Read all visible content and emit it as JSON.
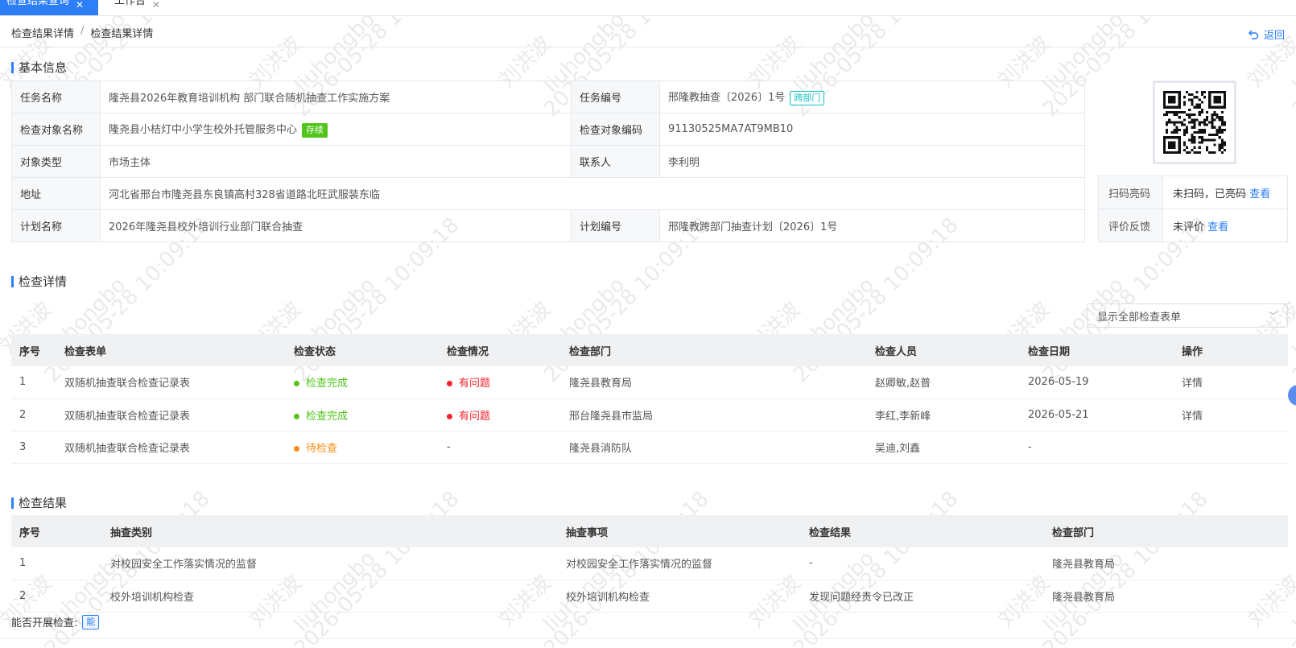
{
  "tabs": [
    {
      "label": "检查结果查询"
    },
    {
      "label": "工作台"
    }
  ],
  "breadcrumb": {
    "first": "检查结果详情",
    "second": "检查结果详情"
  },
  "back_label": "返回",
  "basic": {
    "title": "基本信息",
    "task_name_k": "任务名称",
    "task_name_v": "隆尧县2026年教育培训机构 部门联合随机抽查工作实施方案",
    "task_no_k": "任务编号",
    "task_no_v": "邢隆教抽查〔2026〕1号",
    "task_no_tag": "跨部门",
    "obj_name_k": "检查对象名称",
    "obj_name_v": "隆尧县小桔灯中小学生校外托管服务中心",
    "obj_name_tag": "存续",
    "obj_code_k": "检查对象编码",
    "obj_code_v": "91130525MA7AT9MB10",
    "obj_type_k": "对象类型",
    "obj_type_v": "市场主体",
    "contact_k": "联系人",
    "contact_v": "李利明",
    "addr_k": "地址",
    "addr_v": "河北省邢台市隆尧县东良镇高村328省道路北旺武服装东临",
    "plan_name_k": "计划名称",
    "plan_name_v": "2026年隆尧县校外培训行业部门联合抽查",
    "plan_no_k": "计划编号",
    "plan_no_v": "邢隆教跨部门抽查计划〔2026〕1号"
  },
  "side": {
    "scan_k": "扫码亮码",
    "scan_v": "未扫码，已亮码",
    "scan_link": "查看",
    "eval_k": "评价反馈",
    "eval_v": "未评价",
    "eval_link": "查看"
  },
  "detail": {
    "title": "检查详情",
    "select_value": "显示全部检查表单",
    "headers": [
      "序号",
      "检查表单",
      "检查状态",
      "检查情况",
      "检查部门",
      "检查人员",
      "检查日期",
      "操作"
    ],
    "rows": [
      {
        "no": "1",
        "form": "双随机抽查联合检查记录表",
        "status": "检查完成",
        "situation": "有问题",
        "dept": "隆尧县教育局",
        "people": "赵卿敏,赵普",
        "date": "2026-05-19",
        "op": "详情"
      },
      {
        "no": "2",
        "form": "双随机抽查联合检查记录表",
        "status": "检查完成",
        "situation": "有问题",
        "dept": "邢台隆尧县市监局",
        "people": "李红,李新峰",
        "date": "2026-05-21",
        "op": "详情"
      },
      {
        "no": "3",
        "form": "双随机抽查联合检查记录表",
        "status": "待检查",
        "situation": "-",
        "dept": "隆尧县消防队",
        "people": "吴迪,刘鑫",
        "date": "-",
        "op": ""
      }
    ]
  },
  "result": {
    "title": "检查结果",
    "headers": [
      "序号",
      "抽查类别",
      "抽查事项",
      "检查结果",
      "检查部门"
    ],
    "rows": [
      {
        "no": "1",
        "cat": "对校园安全工作落实情况的监督",
        "item": "对校园安全工作落实情况的监督",
        "res": "-",
        "dept": "隆尧县教育局"
      },
      {
        "no": "2",
        "cat": "校外培训机构检查",
        "item": "校外培训机构检查",
        "res": "发现问题经责令已改正",
        "dept": "隆尧县教育局"
      }
    ]
  },
  "can_check": {
    "label": "能否开展检查:",
    "value": "能"
  },
  "watermark": {
    "name": "刘洪波",
    "user": "liuhongbo",
    "time": "2026-05-28 10:09:18"
  },
  "colors": {
    "accent": "#2d7ff9",
    "done": "#52c41a",
    "problem": "#f5222d",
    "pending": "#fa8c16"
  }
}
